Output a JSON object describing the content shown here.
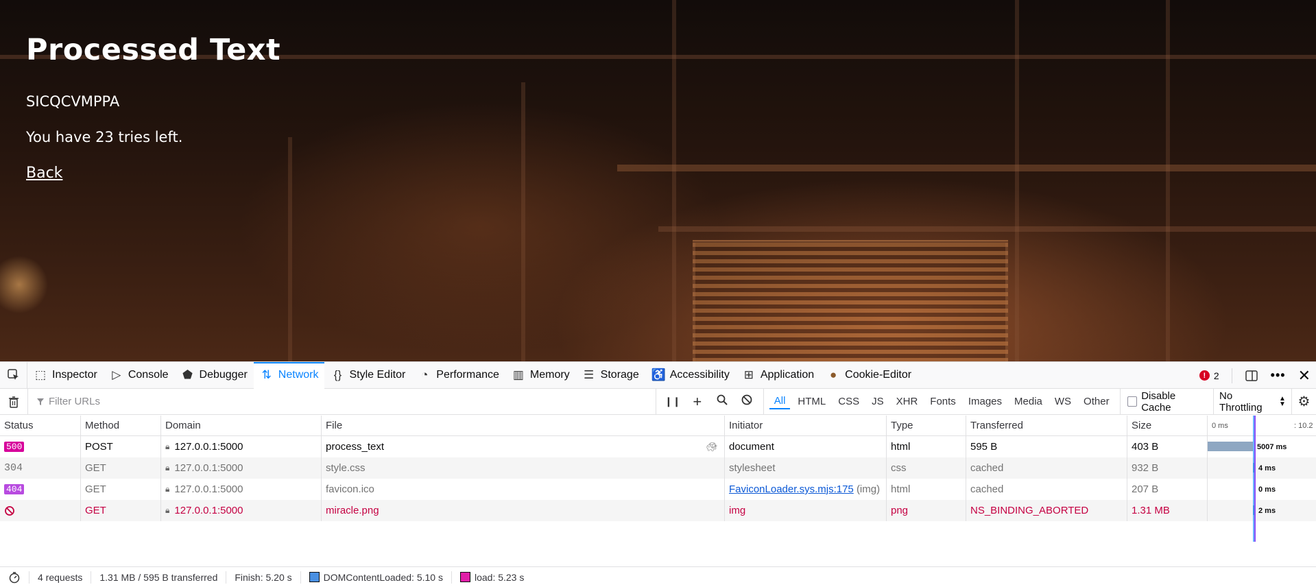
{
  "page": {
    "title": "Processed Text",
    "processed_value": "SICQCVMPPA",
    "tries_message": "You have 23 tries left.",
    "back_link": "Back"
  },
  "devtools": {
    "tabs": [
      {
        "label": "Inspector",
        "icon": "inspector-icon"
      },
      {
        "label": "Console",
        "icon": "console-icon"
      },
      {
        "label": "Debugger",
        "icon": "debugger-icon"
      },
      {
        "label": "Network",
        "icon": "network-icon",
        "selected": true
      },
      {
        "label": "Style Editor",
        "icon": "style-editor-icon"
      },
      {
        "label": "Performance",
        "icon": "performance-icon"
      },
      {
        "label": "Memory",
        "icon": "memory-icon"
      },
      {
        "label": "Storage",
        "icon": "storage-icon"
      },
      {
        "label": "Accessibility",
        "icon": "accessibility-icon"
      },
      {
        "label": "Application",
        "icon": "application-icon"
      },
      {
        "label": "Cookie-Editor",
        "icon": "cookie-icon"
      }
    ],
    "error_count": "2",
    "toolbar": {
      "filter_placeholder": "Filter URLs",
      "type_filters": [
        "All",
        "HTML",
        "CSS",
        "JS",
        "XHR",
        "Fonts",
        "Images",
        "Media",
        "WS",
        "Other"
      ],
      "active_filter": "All",
      "disable_cache_label": "Disable Cache",
      "throttling_label": "No Throttling"
    },
    "columns": [
      "Status",
      "Method",
      "Domain",
      "File",
      "Initiator",
      "Type",
      "Transferred",
      "Size"
    ],
    "waterfall_header": {
      "start": "0 ms",
      "end": ": 10.2"
    },
    "requests": [
      {
        "status": "500",
        "method": "POST",
        "domain": "127.0.0.1:5000",
        "file": "process_text",
        "initiator": "document",
        "type": "html",
        "transferred": "595 B",
        "size": "403 B",
        "timing": "5007 ms"
      },
      {
        "status": "304",
        "method": "GET",
        "domain": "127.0.0.1:5000",
        "file": "style.css",
        "initiator": "stylesheet",
        "type": "css",
        "transferred": "cached",
        "size": "932 B",
        "timing": "4 ms"
      },
      {
        "status": "404",
        "method": "GET",
        "domain": "127.0.0.1:5000",
        "file": "favicon.ico",
        "initiator": "FaviconLoader.sys.mjs:175",
        "initiator_suffix": "(img)",
        "type": "html",
        "transferred": "cached",
        "size": "207 B",
        "timing": "0 ms"
      },
      {
        "status": "",
        "method": "GET",
        "domain": "127.0.0.1:5000",
        "file": "miracle.png",
        "initiator": "img",
        "type": "png",
        "transferred": "NS_BINDING_ABORTED",
        "size": "1.31 MB",
        "timing": "2 ms"
      }
    ],
    "statusbar": {
      "requests": "4 requests",
      "transferred": "1.31 MB / 595 B transferred",
      "finish": "Finish: 5.20 s",
      "dom_content_loaded": "DOMContentLoaded: 5.10 s",
      "load": "load: 5.23 s"
    },
    "colors": {
      "accent": "#0a84ff",
      "status_500": "#d7009b",
      "status_404": "#b84be0",
      "error_red": "#c50042"
    }
  }
}
